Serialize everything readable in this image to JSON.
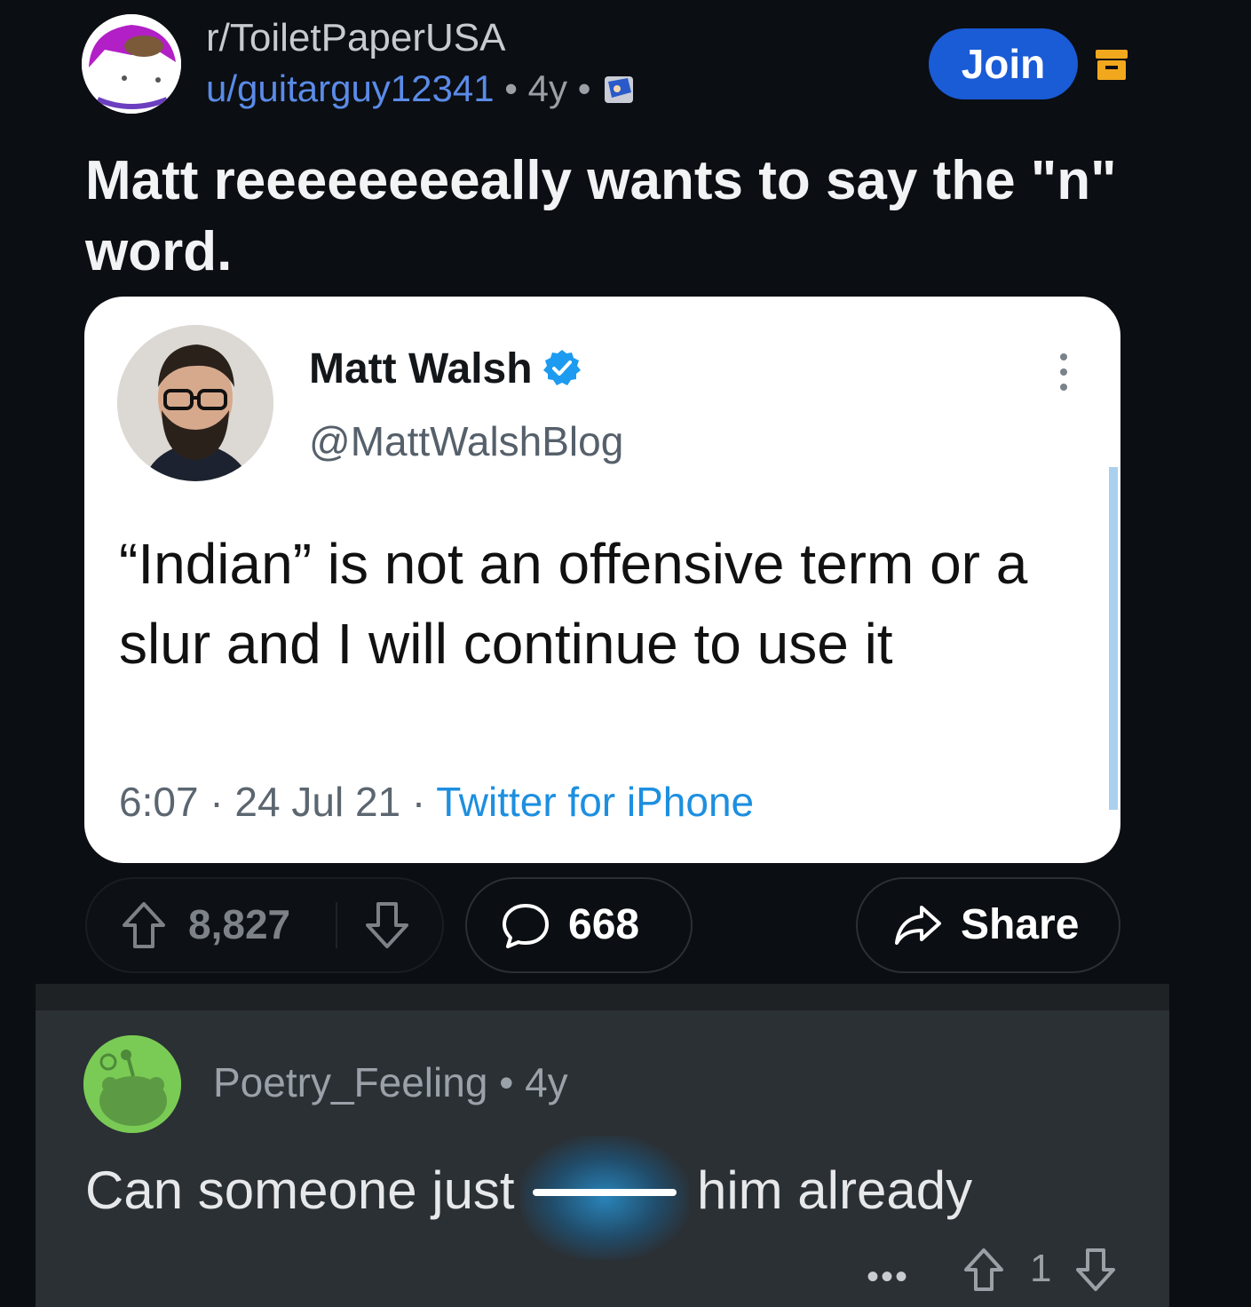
{
  "post": {
    "subreddit": "r/ToiletPaperUSA",
    "author": "u/guitarguy12341",
    "separator": "•",
    "age": "4y",
    "join_label": "Join",
    "title": "Matt reeeeeeeeally wants to say the \"n\" word."
  },
  "tweet": {
    "name": "Matt Walsh",
    "handle": "@MattWalshBlog",
    "text": "“Indian” is not an offensive term or a slur and I will continue to use it",
    "time": "6:07",
    "dot": "·",
    "date": "24 Jul 21",
    "source": "Twitter for iPhone",
    "verified_color": "#1d9bf0"
  },
  "actions": {
    "upvotes": "8,827",
    "comments": "668",
    "share_label": "Share"
  },
  "comment": {
    "user": "Poetry_Feeling",
    "separator": "•",
    "age": "4y",
    "text_before": "Can someone just",
    "text_after": "him already",
    "more": "•••",
    "score": "1"
  },
  "colors": {
    "background": "#0b0e12",
    "join_button": "#1a5bd6",
    "archive_icon": "#f2a81d",
    "link_blue": "#1d8fe0"
  }
}
